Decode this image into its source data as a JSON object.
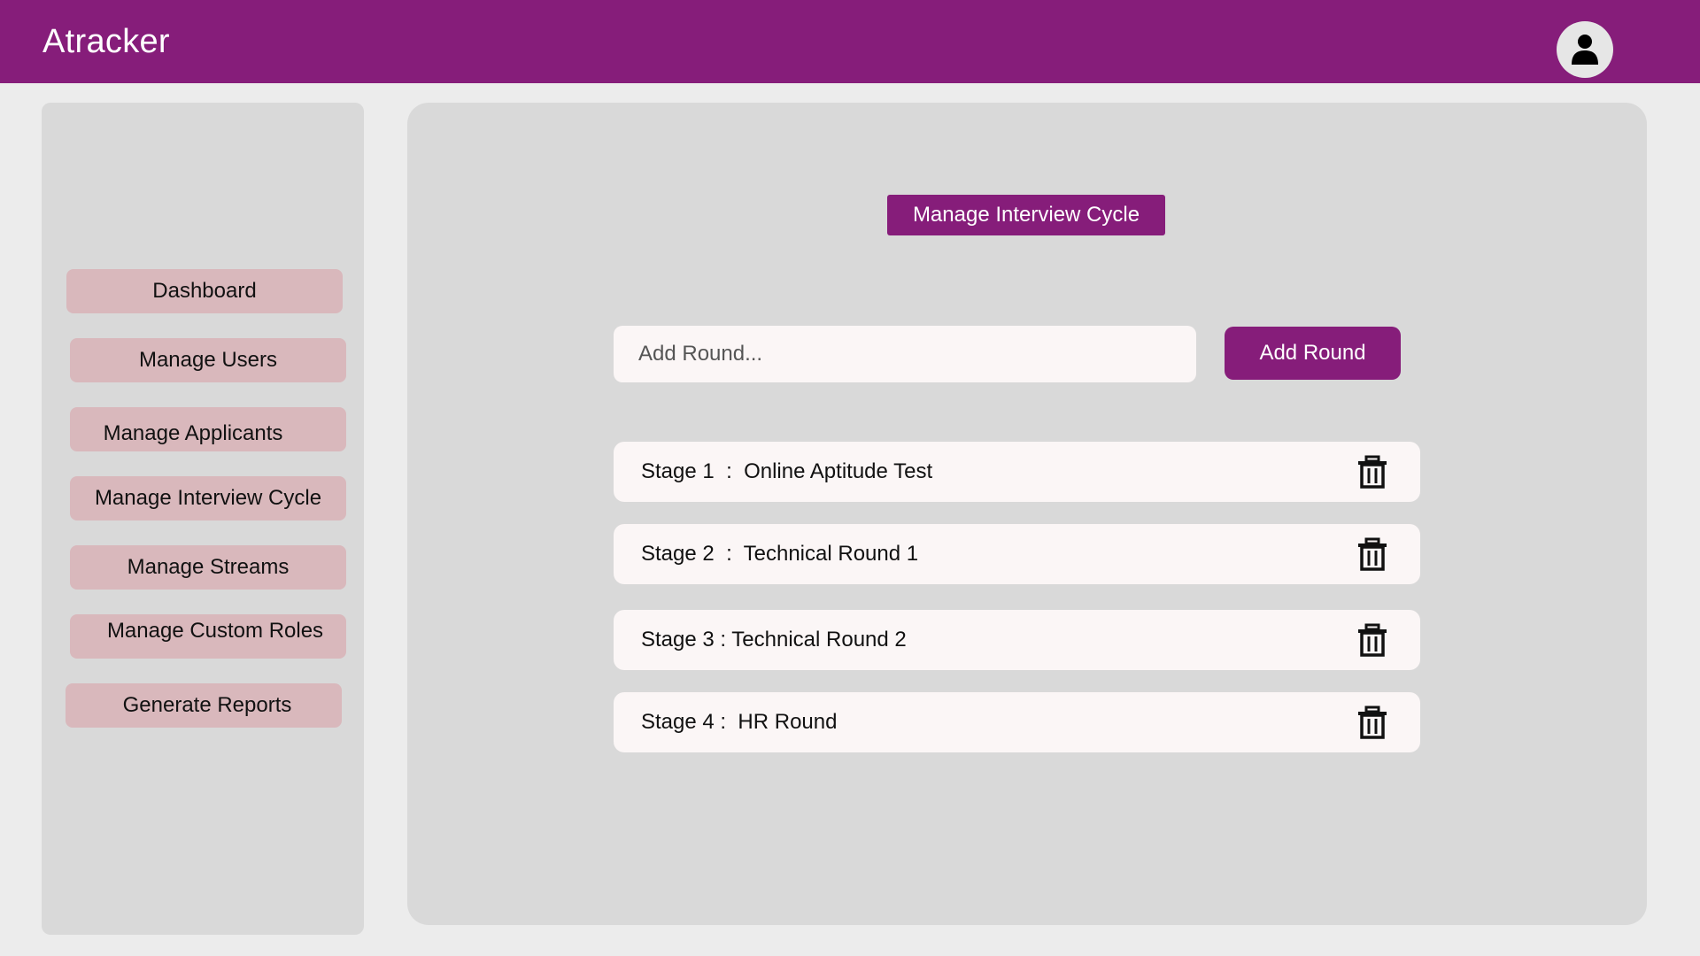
{
  "app": {
    "title": "Atracker"
  },
  "header": {
    "avatar_icon": "user-icon"
  },
  "sidebar": {
    "items": [
      {
        "label": "Dashboard"
      },
      {
        "label": "Manage Users"
      },
      {
        "label": "Manage Applicants"
      },
      {
        "label": "Manage Interview Cycle"
      },
      {
        "label": "Manage Streams"
      },
      {
        "label": "Manage Custom Roles"
      },
      {
        "label": "Generate Reports"
      }
    ]
  },
  "main": {
    "title": "Manage Interview Cycle",
    "add_round": {
      "placeholder": "Add Round...",
      "button_label": "Add Round"
    },
    "stages": [
      {
        "text": "Stage 1  :  Online Aptitude Test"
      },
      {
        "text": "Stage 2  :  Technical Round 1"
      },
      {
        "text": "Stage 3 : Technical Round 2"
      },
      {
        "text": "Stage 4 :  HR Round"
      }
    ],
    "delete_icon": "trash-icon"
  },
  "colors": {
    "brand": "#861d7a",
    "sidebar_button": "#d9b8bc",
    "panel": "#d9d9d9",
    "row": "#fbf6f6"
  }
}
